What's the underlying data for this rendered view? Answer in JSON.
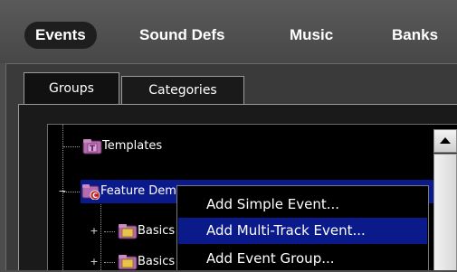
{
  "top_tabs": [
    {
      "label": "Events",
      "active": true
    },
    {
      "label": "Sound Defs",
      "active": false
    },
    {
      "label": "Music",
      "active": false
    },
    {
      "label": "Banks",
      "active": false
    }
  ],
  "sub_tabs": [
    {
      "label": "Groups",
      "active": true
    },
    {
      "label": "Categories",
      "active": false
    }
  ],
  "tree": {
    "items": [
      {
        "label": "Templates",
        "icon": "template-folder-icon"
      },
      {
        "label": "Feature Demonstration",
        "icon": "category-folder-icon",
        "selected": true
      },
      {
        "label": "Basics",
        "icon": "folder-icon"
      },
      {
        "label": "Basics",
        "icon": "folder-icon"
      }
    ]
  },
  "context_menu": {
    "items": [
      {
        "label": "Add Simple Event..."
      },
      {
        "label": "Add Multi-Track Event...",
        "highlighted": true
      },
      {
        "label": "Add Event Group..."
      }
    ]
  },
  "colors": {
    "selection": "#0a1a8a",
    "background": "#4d4d4d",
    "tree_background": "#000000"
  }
}
